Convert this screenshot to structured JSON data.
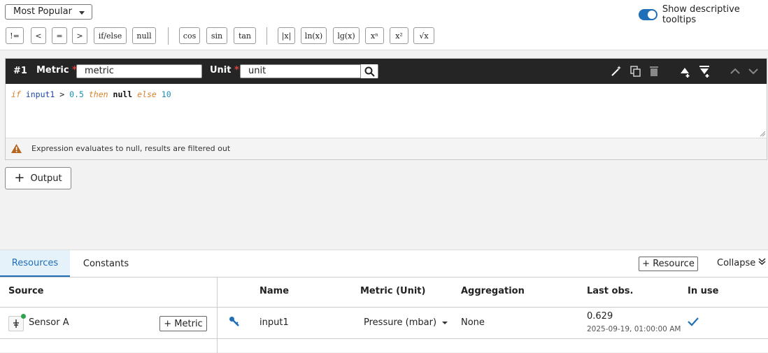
{
  "toolbar": {
    "dropdown_value": "Most Popular",
    "tooltips_label": "Show descriptive tooltips",
    "tooltips_on": true,
    "function_buttons": [
      "!=",
      "<",
      "=",
      ">",
      "if/else",
      "null",
      "cos",
      "sin",
      "tan",
      "|x|",
      "ln(x)",
      "lg(x)",
      "xⁿ",
      "x²",
      "√x"
    ]
  },
  "expression": {
    "number": "#1",
    "metric_label": "Metric",
    "metric_value": "metric",
    "unit_label": "Unit",
    "unit_value": "unit",
    "required_mark": "*",
    "code": {
      "if": "if",
      "var": "input1",
      "op": ">",
      "threshold": "0.5",
      "then": "then",
      "then_value": "null",
      "else": "else",
      "else_value": "10"
    },
    "warning": "Expression evaluates to null, results are filtered out"
  },
  "output_button": "Output",
  "bottom": {
    "tabs": [
      "Resources",
      "Constants"
    ],
    "resource_button": "+ Resource",
    "collapse_label": "Collapse",
    "headers": {
      "source": "Source",
      "name": "Name",
      "metric_unit": "Metric (Unit)",
      "aggregation": "Aggregation",
      "last_obs": "Last obs.",
      "in_use": "In use"
    },
    "row": {
      "source": "Sensor A",
      "metric_button": "+ Metric",
      "name": "input1",
      "metric_unit": "Pressure (mbar)",
      "aggregation": "None",
      "last_value": "0.629",
      "last_time": "2025-09-19, 01:00:00 AM",
      "in_use": true
    }
  },
  "colors": {
    "accent": "#1f6fb8",
    "header_bg": "#252525",
    "keyword": "#d9822b",
    "number": "#1a8fb8",
    "warning": "#b5651d",
    "status_dot": "#2ea44f"
  }
}
